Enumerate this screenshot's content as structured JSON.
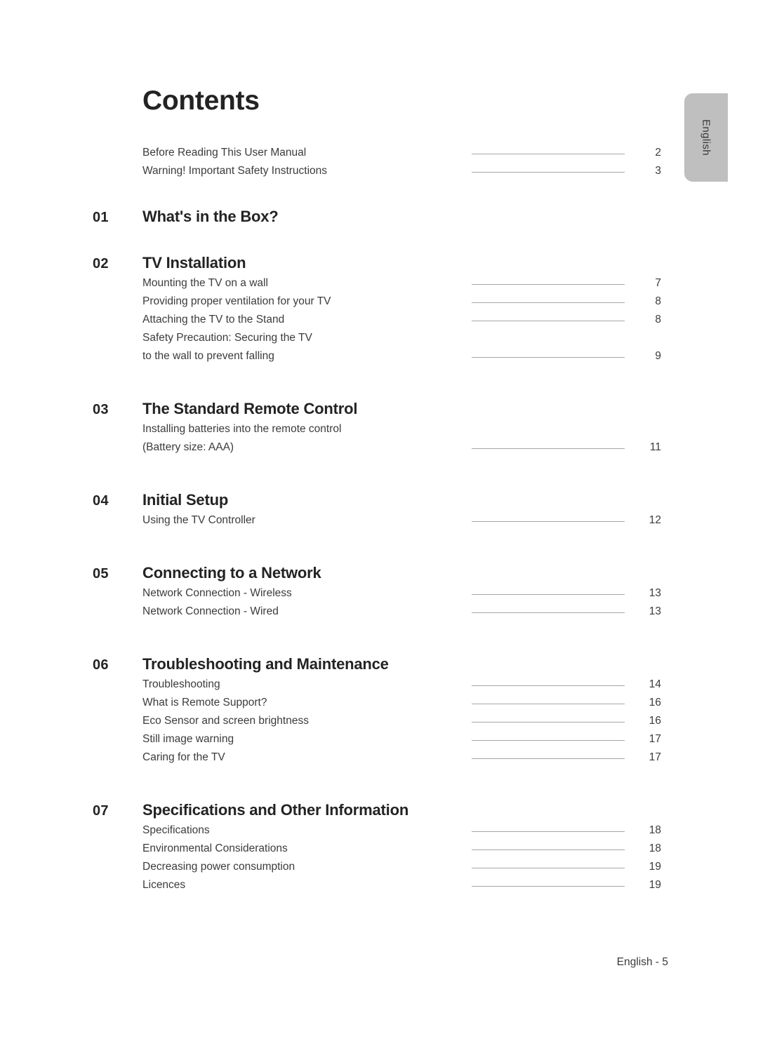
{
  "page": {
    "title": "Contents",
    "language_tab": "English",
    "footer": "English - 5"
  },
  "intro_entries": [
    {
      "label": "Before Reading This User Manual",
      "page": "2"
    },
    {
      "label": "Warning! Important Safety Instructions",
      "page": "3"
    }
  ],
  "sections": [
    {
      "number": "01",
      "title": "What's in the Box?",
      "items": []
    },
    {
      "number": "02",
      "title": "TV Installation",
      "items": [
        {
          "label": "Mounting the TV on a wall",
          "page": "7"
        },
        {
          "label": "Providing proper ventilation for your TV",
          "page": "8"
        },
        {
          "label": "Attaching the TV to the Stand",
          "page": "8"
        },
        {
          "label": "Safety Precaution: Securing the TV",
          "page": ""
        },
        {
          "label": "to the wall to prevent falling",
          "page": "9"
        }
      ]
    },
    {
      "number": "03",
      "title": "The Standard Remote Control",
      "items": [
        {
          "label": "Installing batteries into the remote control",
          "page": ""
        },
        {
          "label": "(Battery size: AAA)",
          "page": "11"
        }
      ]
    },
    {
      "number": "04",
      "title": "Initial Setup",
      "items": [
        {
          "label": "Using the TV Controller",
          "page": "12"
        }
      ]
    },
    {
      "number": "05",
      "title": "Connecting to a Network",
      "items": [
        {
          "label": "Network Connection - Wireless",
          "page": "13"
        },
        {
          "label": "Network Connection - Wired",
          "page": "13"
        }
      ]
    },
    {
      "number": "06",
      "title": "Troubleshooting and Maintenance",
      "items": [
        {
          "label": "Troubleshooting",
          "page": "14"
        },
        {
          "label": "What is Remote Support?",
          "page": "16"
        },
        {
          "label": "Eco Sensor and screen brightness",
          "page": "16"
        },
        {
          "label": "Still image warning",
          "page": "17"
        },
        {
          "label": "Caring for the TV",
          "page": "17"
        }
      ]
    },
    {
      "number": "07",
      "title": "Specifications and Other Information",
      "items": [
        {
          "label": "Specifications",
          "page": "18"
        },
        {
          "label": "Environmental Considerations",
          "page": "18"
        },
        {
          "label": "Decreasing power consumption",
          "page": "19"
        },
        {
          "label": "Licences",
          "page": "19"
        }
      ]
    }
  ]
}
